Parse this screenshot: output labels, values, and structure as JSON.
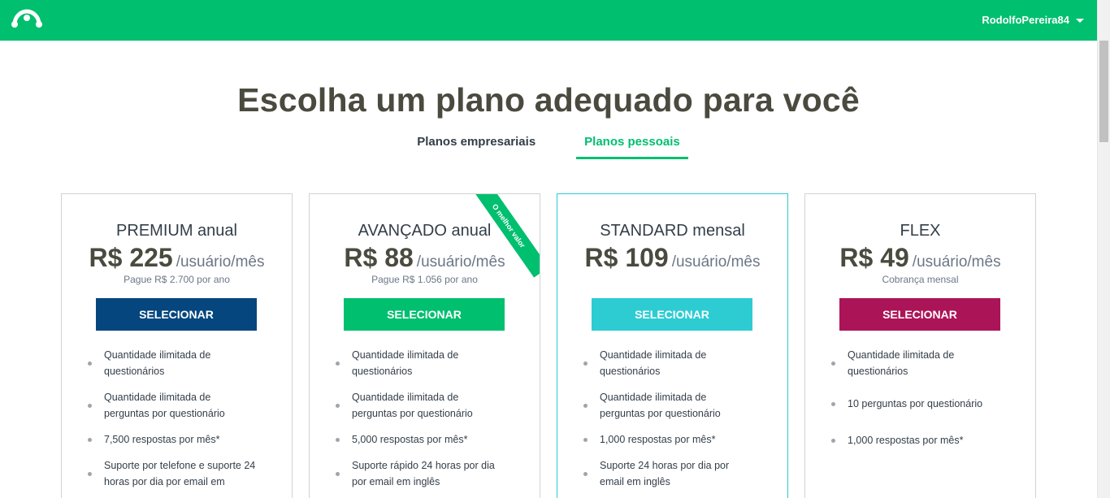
{
  "header": {
    "username": "RodolfoPereira84"
  },
  "page": {
    "title": "Escolha um plano adequado para você"
  },
  "tabs": [
    {
      "label": "Planos empresariais",
      "active": false
    },
    {
      "label": "Planos pessoais",
      "active": true
    }
  ],
  "plans": [
    {
      "name": "PREMIUM anual",
      "price": "R$ 225",
      "per": "/usuário/mês",
      "billing": "Pague R$ 2.700 por ano",
      "button": "SELECIONAR",
      "button_color": "#05467e",
      "features": [
        "Quantidade ilimitada de questionários",
        "Quantidade ilimitada de perguntas por questionário",
        "7,500 respostas por mês*",
        "Suporte por telefone e suporte 24 horas por dia por email em"
      ]
    },
    {
      "name": "AVANÇADO anual",
      "price": "R$ 88",
      "per": "/usuário/mês",
      "billing": "Pague R$ 1.056 por ano",
      "button": "SELECIONAR",
      "button_color": "#00bf6f",
      "ribbon": "O melhor valor",
      "features": [
        "Quantidade ilimitada de questionários",
        "Quantidade ilimitada de perguntas por questionário",
        "5,000 respostas por mês*",
        "Suporte rápido 24 horas por dia por email em inglês"
      ]
    },
    {
      "name": "STANDARD mensal",
      "price": "R$ 109",
      "per": "/usuário/mês",
      "billing": "",
      "button": "SELECIONAR",
      "button_color": "#2dccd3",
      "features": [
        "Quantidade ilimitada de questionários",
        "Quantidade ilimitada de perguntas por questionário",
        "1,000 respostas por mês*",
        "Suporte 24 horas por dia por email em inglês"
      ]
    },
    {
      "name": "FLEX",
      "price": "R$ 49",
      "per": "/usuário/mês",
      "billing": "Cobrança mensal",
      "button": "SELECIONAR",
      "button_color": "#ac1458",
      "features": [
        "Quantidade ilimitada de questionários",
        "10 perguntas por questionário",
        "1,000 respostas por mês*"
      ]
    }
  ],
  "colors": {
    "brand": "#00bf6f",
    "highlight_border": "#2dccd3"
  },
  "icons": {
    "logo": "surveymonkey-logo",
    "user_menu": "caret-down-icon"
  }
}
